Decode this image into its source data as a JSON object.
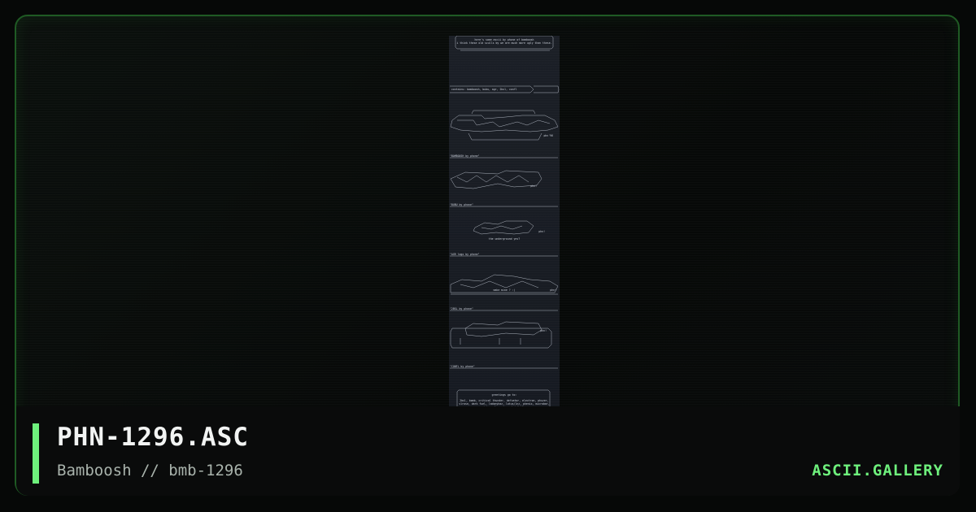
{
  "artwork": {
    "title": "PHN-1296.ASC",
    "byline": "Bamboosh // bmb-1296",
    "ascii_lines": {
      "header_1": "here's some ascii by phone of bamboosh",
      "header_2": "i think these old sculls by we are much more ugly than these.",
      "tools_line": "contains: bamboosh, bubu, agr, 2bsl, confl",
      "logo_1_tag": "phn'96",
      "logo_1_caption": "\"BAMBOOSH by phone\"",
      "logo_2_tag": "phn!",
      "logo_2_caption": "\"BUBU by phone\"",
      "logo_3_tag": "phn!",
      "logo_3_sub": "the underground yes?",
      "logo_3_caption": "\"AGR logo by phone\"",
      "logo_4_sub": "make mine ? :)",
      "logo_4_tag": "phn!",
      "logo_4_caption": "\"2BSL by phone\"",
      "logo_5_tag": "phn!",
      "logo_5_caption": "\"CONFL by phone\"",
      "greets_title": "greetings go to:",
      "greets_1": "2bsl, bomb, critical thunder, defcator, electron, phuzer,",
      "greets_2": "vlrose, dark fuel, ladonyhaz, lotus/lnz, phenix, microbar,",
      "greets_3": "pinion, fermentor, tripleklex",
      "greets_4": "if you have something to say me or if you want to",
      "greets_5": "request ascii, send e-mail to:",
      "greets_6": "phone@bird :)"
    }
  },
  "brand": {
    "name": "ASCII.GALLERY"
  },
  "colors": {
    "accent": "#6ef07c",
    "frame_border": "#1f5a24",
    "art_background": "#1b1f26"
  }
}
